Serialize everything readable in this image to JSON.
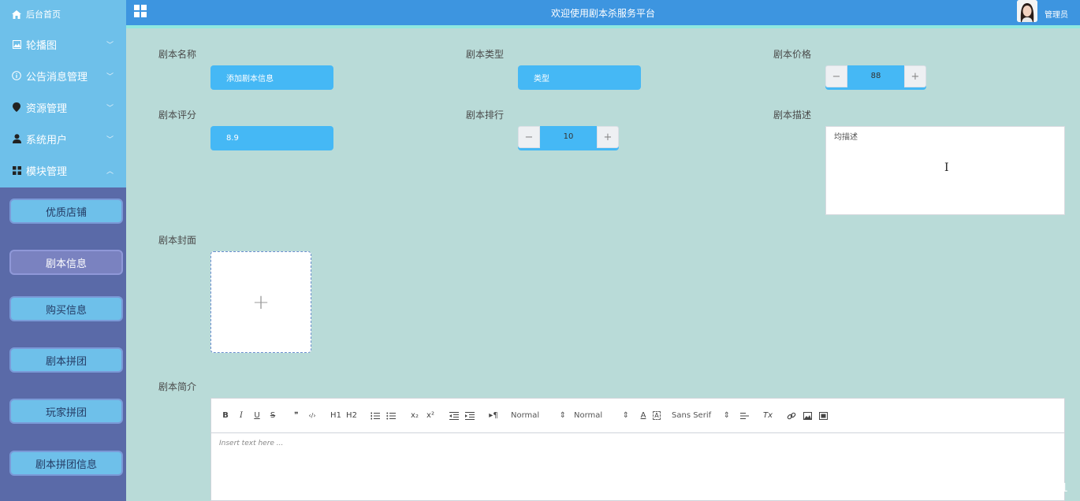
{
  "header": {
    "title": "欢迎使用剧本杀服务平台",
    "admin_label": "管理员"
  },
  "sidebar": {
    "home": "后台首页",
    "menu": [
      {
        "label": "轮播图",
        "icon": "image-icon"
      },
      {
        "label": "公告消息管理",
        "icon": "info-icon"
      },
      {
        "label": "资源管理",
        "icon": "location-icon"
      },
      {
        "label": "系统用户",
        "icon": "user-icon"
      },
      {
        "label": "模块管理",
        "icon": "grid-icon"
      }
    ],
    "submenu": [
      "优质店铺",
      "剧本信息",
      "购买信息",
      "剧本拼团",
      "玩家拼团",
      "剧本拼团信息"
    ],
    "active_submenu": "剧本信息"
  },
  "form": {
    "name": {
      "label": "剧本名称",
      "value": "添加剧本信息"
    },
    "type": {
      "label": "剧本类型",
      "value": "类型"
    },
    "price": {
      "label": "剧本价格",
      "value": "88"
    },
    "rating": {
      "label": "剧本评分",
      "value": "8.9"
    },
    "rank": {
      "label": "剧本排行",
      "value": "10"
    },
    "desc": {
      "label": "剧本描述",
      "value": "均描述"
    },
    "cover": {
      "label": "剧本封面",
      "add_symbol": "+"
    },
    "intro": {
      "label": "剧本简介",
      "placeholder": "Insert text here ...",
      "toolbar": {
        "bold": "B",
        "italic": "I",
        "underline": "U",
        "strike": "S",
        "blockquote": "❞",
        "code": "‹/›",
        "h1": "H1",
        "h2": "H2",
        "sub": "x₂",
        "sup": "x²",
        "size_value": "Normal",
        "header_value": "Normal",
        "font_value": "Sans Serif",
        "clean": "Tx"
      }
    }
  },
  "watermark": "CSDN @QQ177825331"
}
